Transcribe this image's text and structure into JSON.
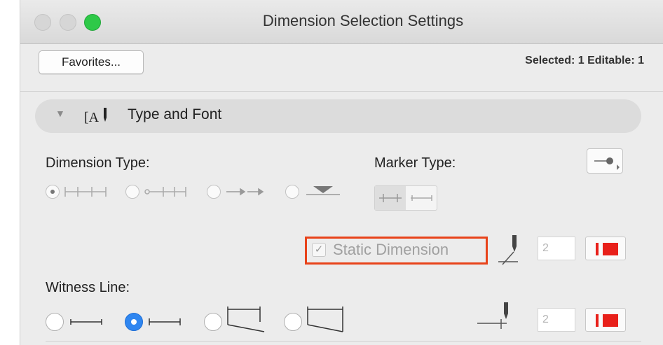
{
  "window": {
    "title": "Dimension Selection Settings"
  },
  "toolbar": {
    "favorites_label": "Favorites...",
    "selection_info": "Selected: 1 Editable: 1"
  },
  "section": {
    "title": "Type and Font",
    "icon": "type-and-font-icon",
    "expanded": true
  },
  "dimension_type": {
    "label": "Dimension Type:",
    "options": [
      "linear-dimension",
      "cumulative-dimension",
      "arrow-dimension",
      "elevation-dimension"
    ],
    "selected_index": 0
  },
  "marker_type": {
    "label": "Marker Type:",
    "options": [
      "tick-marker",
      "arrow-marker"
    ],
    "selected_index": 0
  },
  "static_dimension": {
    "label": "Static Dimension",
    "checked": true,
    "pen_number": "2",
    "color": "#e8201a",
    "highlight_color": "#e8431a"
  },
  "witness_line": {
    "label": "Witness Line:",
    "options": [
      "witness-line-none",
      "witness-line-fixed",
      "witness-line-gap",
      "witness-line-sloped"
    ],
    "selected_index": 1,
    "pen_number": "2",
    "color": "#e8201a"
  },
  "colors": {
    "accent": "#2f86f0",
    "close_button_green": "#2ec948"
  }
}
